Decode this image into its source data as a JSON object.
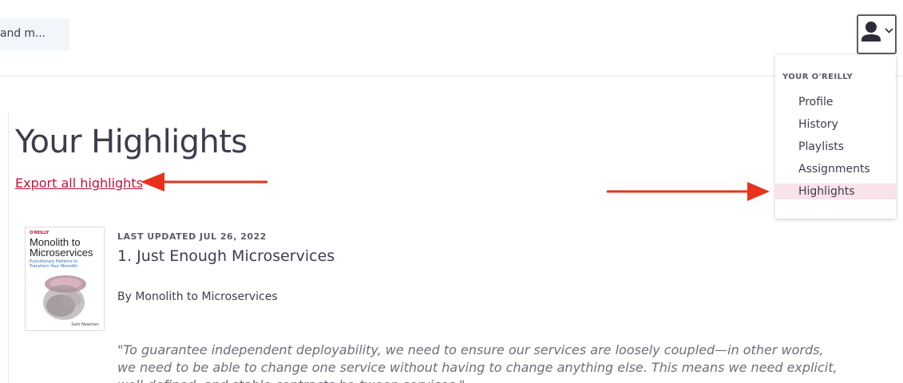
{
  "search": {
    "text": "and m..."
  },
  "user_menu": {
    "header": "YOUR O'REILLY",
    "items": [
      {
        "label": "Profile",
        "active": false
      },
      {
        "label": "History",
        "active": false
      },
      {
        "label": "Playlists",
        "active": false
      },
      {
        "label": "Assignments",
        "active": false
      },
      {
        "label": "Highlights",
        "active": true
      }
    ]
  },
  "page": {
    "title": "Your Highlights",
    "export_label": "Export all highlights"
  },
  "highlight": {
    "cover": {
      "brand": "O'REILLY",
      "title": "Monolith to Microservices",
      "subtitle": "Evolutionary Patterns to Transform Your Monolith",
      "author": "Sam Newman"
    },
    "updated": "LAST UPDATED JUL 26, 2022",
    "chapter": "1. Just Enough Microservices",
    "byline": "By Monolith to Microservices",
    "quote": "\"To guarantee independent deployability, we need to ensure our services are loosely coupled—in other words, we need to be able to change one service without having to change anything else. This means we need explicit, well-defined, and stable contracts be-tween services.\""
  },
  "colors": {
    "accent": "#c5113a",
    "arrow": "#e8321e",
    "active_bg": "#f9e3ea",
    "text": "#3d3d4e"
  }
}
